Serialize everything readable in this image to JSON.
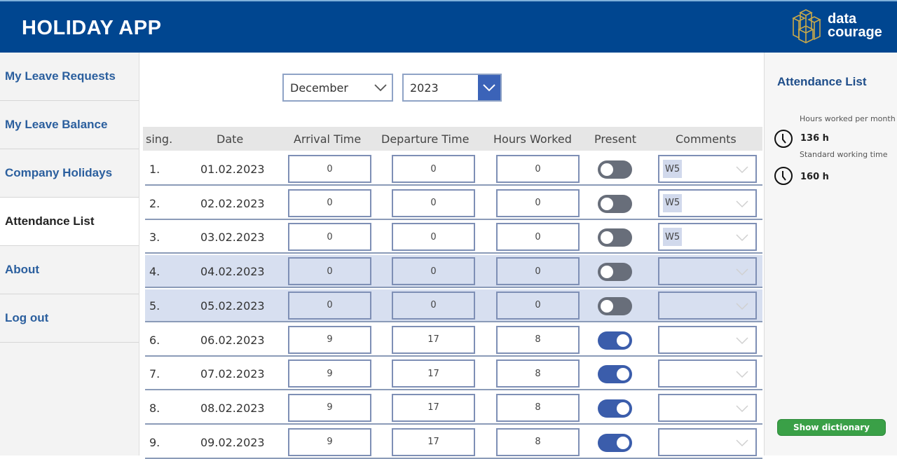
{
  "header": {
    "title": "HOLIDAY APP",
    "logo_line1": "data",
    "logo_line2": "courage"
  },
  "sidebar": {
    "items": [
      {
        "label": "My Leave Requests",
        "active": false
      },
      {
        "label": "My Leave Balance",
        "active": false
      },
      {
        "label": "Company Holidays",
        "active": false
      },
      {
        "label": "Attendance List",
        "active": true
      },
      {
        "label": "About",
        "active": false
      },
      {
        "label": "Log out",
        "active": false
      }
    ]
  },
  "filters": {
    "month": "December",
    "year": "2023"
  },
  "table": {
    "columns": [
      "sing.",
      "Date",
      "Arrival Time",
      "Departure Time",
      "Hours Worked",
      "Present",
      "Comments"
    ],
    "rows": [
      {
        "num": "1.",
        "date": "01.02.2023",
        "arrival": "0",
        "departure": "0",
        "hours": "0",
        "present": false,
        "comment": "W5",
        "weekend": false
      },
      {
        "num": "2.",
        "date": "02.02.2023",
        "arrival": "0",
        "departure": "0",
        "hours": "0",
        "present": false,
        "comment": "W5",
        "weekend": false
      },
      {
        "num": "3.",
        "date": "03.02.2023",
        "arrival": "0",
        "departure": "0",
        "hours": "0",
        "present": false,
        "comment": "W5",
        "weekend": false
      },
      {
        "num": "4.",
        "date": "04.02.2023",
        "arrival": "0",
        "departure": "0",
        "hours": "0",
        "present": false,
        "comment": "",
        "weekend": true
      },
      {
        "num": "5.",
        "date": "05.02.2023",
        "arrival": "0",
        "departure": "0",
        "hours": "0",
        "present": false,
        "comment": "",
        "weekend": true
      },
      {
        "num": "6.",
        "date": "06.02.2023",
        "arrival": "9",
        "departure": "17",
        "hours": "8",
        "present": true,
        "comment": "",
        "weekend": false
      },
      {
        "num": "7.",
        "date": "07.02.2023",
        "arrival": "9",
        "departure": "17",
        "hours": "8",
        "present": true,
        "comment": "",
        "weekend": false
      },
      {
        "num": "8.",
        "date": "08.02.2023",
        "arrival": "9",
        "departure": "17",
        "hours": "8",
        "present": true,
        "comment": "",
        "weekend": false
      },
      {
        "num": "9.",
        "date": "09.02.2023",
        "arrival": "9",
        "departure": "17",
        "hours": "8",
        "present": true,
        "comment": "",
        "weekend": false
      }
    ]
  },
  "summary": {
    "title": "Attendance List",
    "hours_worked_label": "Hours worked per month",
    "hours_worked_value": "136 h",
    "standard_label": "Standard working time",
    "standard_value": "160 h",
    "button_label": "Show dictionary"
  },
  "colors": {
    "brand": "#004690",
    "accent": "#3b5dab",
    "button": "#3aa047"
  }
}
